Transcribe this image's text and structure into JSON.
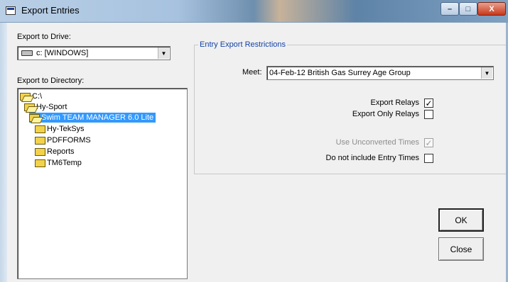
{
  "window": {
    "title": "Export Entries",
    "controls": {
      "minimize": "–",
      "maximize": "□",
      "close": "X"
    }
  },
  "drive": {
    "label": "Export to Drive:",
    "value": "c: [WINDOWS]",
    "icon": "drive-icon"
  },
  "directory": {
    "label": "Export to Directory:",
    "items": [
      {
        "label": "C:\\",
        "open": true,
        "selected": false
      },
      {
        "label": "Hy-Sport",
        "open": true,
        "selected": false
      },
      {
        "label": "Swim TEAM MANAGER 6.0 Lite",
        "open": true,
        "selected": true
      },
      {
        "label": "Hy-TekSys",
        "open": false,
        "selected": false
      },
      {
        "label": "PDFFORMS",
        "open": false,
        "selected": false
      },
      {
        "label": "Reports",
        "open": false,
        "selected": false
      },
      {
        "label": "TM6Temp",
        "open": false,
        "selected": false
      }
    ]
  },
  "restrictions": {
    "title": "Entry Export Restrictions",
    "meet_label": "Meet:",
    "meet_value": "04-Feb-12 British Gas Surrey Age Group",
    "options": {
      "export_relays": {
        "label": "Export Relays",
        "checked": true,
        "enabled": true
      },
      "export_only_relays": {
        "label": "Export Only Relays",
        "checked": false,
        "enabled": true
      },
      "use_unconverted": {
        "label": "Use Unconverted Times",
        "checked": true,
        "enabled": false
      },
      "no_entry_times": {
        "label": "Do not include Entry Times",
        "checked": false,
        "enabled": true
      }
    }
  },
  "buttons": {
    "ok": "OK",
    "close": "Close"
  },
  "colors": {
    "group_title": "#1443a6",
    "selection": "#3399ff"
  }
}
